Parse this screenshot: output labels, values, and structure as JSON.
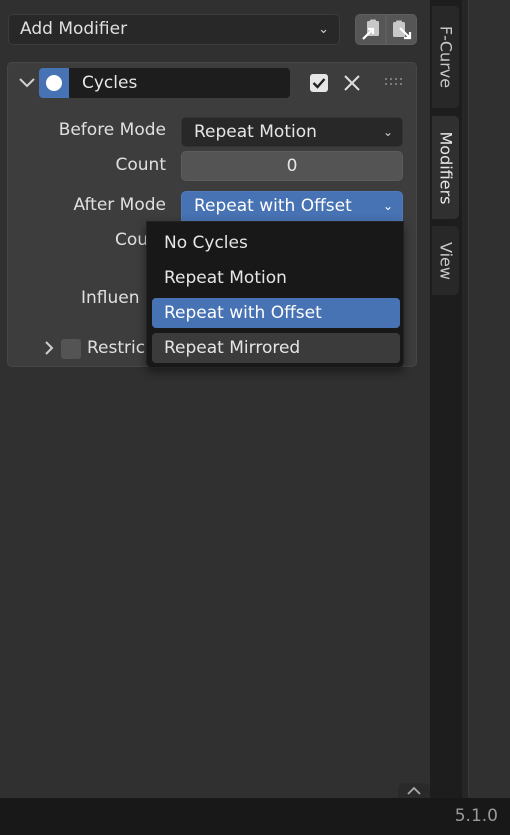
{
  "header": {
    "add_modifier_label": "Add Modifier",
    "copy_icon": "copy-to-clipboard-icon",
    "paste_icon": "paste-from-clipboard-icon"
  },
  "modifier": {
    "name": "Cycles",
    "type_icon": "cycles-modifier-icon",
    "enabled": true,
    "before_mode_label": "Before Mode",
    "before_mode_value": "Repeat Motion",
    "count_label": "Count",
    "count_value": "0",
    "after_mode_label": "After Mode",
    "after_mode_value": "Repeat with Offset",
    "count2_label_partial": "Cou",
    "influence_label_partial": "Influen",
    "restrict_label_partial": "Restric"
  },
  "dropdown": {
    "options": [
      {
        "label": "No Cycles",
        "mnemonic": "N"
      },
      {
        "label": "Repeat Motion",
        "mnemonic": "R"
      },
      {
        "label": "Repeat with Offset",
        "mnemonic": "w"
      },
      {
        "label": "Repeat Mirrored",
        "mnemonic": "M"
      }
    ],
    "highlighted": "Repeat with Offset"
  },
  "tabs": [
    {
      "label": "F-Curve",
      "active": false
    },
    {
      "label": "Modifiers",
      "active": true
    },
    {
      "label": "View",
      "active": false
    }
  ],
  "status": {
    "version": "5.1.0"
  },
  "colors": {
    "accent": "#4772b3",
    "background": "#303030",
    "panel": "#3d3d3d",
    "field": "#282828",
    "menu": "#181818"
  }
}
